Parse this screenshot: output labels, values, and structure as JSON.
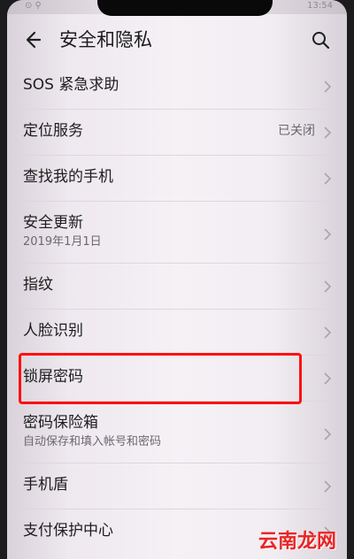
{
  "status": {
    "left": "⊙ ⚲",
    "time": "13:54"
  },
  "header": {
    "title": "安全和隐私",
    "back_icon": "back-arrow-icon",
    "search_icon": "search-icon"
  },
  "items": [
    {
      "label": "SOS 紧急求助"
    },
    {
      "label": "定位服务",
      "value": "已关闭"
    },
    {
      "label": "查找我的手机"
    },
    {
      "label": "安全更新",
      "subtitle": "2019年1月1日"
    },
    {
      "label": "指纹"
    },
    {
      "label": "人脸识别"
    },
    {
      "label": "锁屏密码",
      "highlighted": true
    },
    {
      "label": "密码保险箱",
      "subtitle": "自动保存和填入帐号和密码"
    },
    {
      "label": "手机盾"
    },
    {
      "label": "支付保护中心"
    }
  ],
  "watermark": {
    "text": "云南龙网"
  },
  "colors": {
    "highlight": "#ff1010",
    "watermark": "#e92524"
  }
}
